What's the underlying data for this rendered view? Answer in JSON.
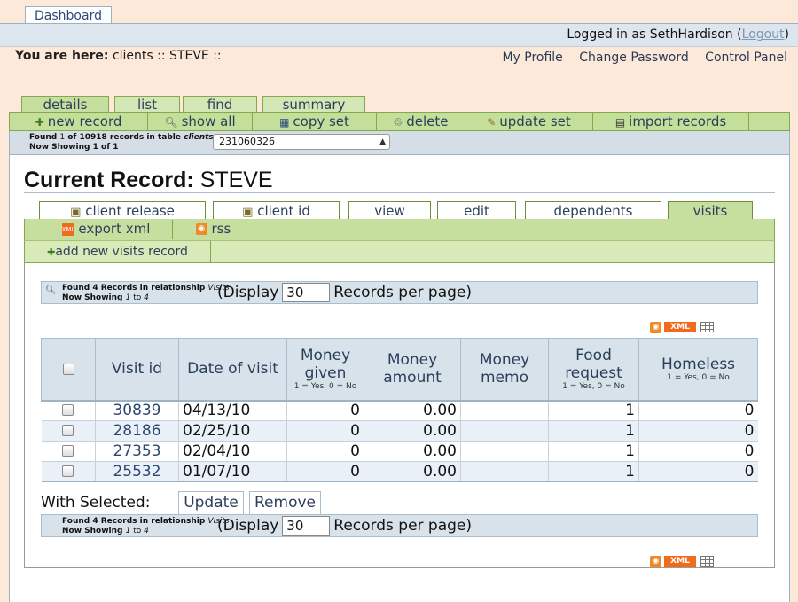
{
  "top": {
    "dashboard_tab": "Dashboard",
    "logged_in_text": "Logged in as SethHardison (",
    "logout": "Logout",
    "close_paren": ")"
  },
  "breadcrumb": {
    "label": "You are here:",
    "path": "clients :: STEVE ::"
  },
  "userlinks": [
    "My Profile",
    "Change Password",
    "Control Panel"
  ],
  "main_tabs": [
    "details",
    "list",
    "find",
    "summary"
  ],
  "actions": [
    {
      "label": "new record",
      "icon": "plus-icon"
    },
    {
      "label": "show all",
      "icon": "magnifier-icon"
    },
    {
      "label": "copy set",
      "icon": "table-icon"
    },
    {
      "label": "delete",
      "icon": "trash-icon"
    },
    {
      "label": "update set",
      "icon": "pencil-icon"
    },
    {
      "label": "import records",
      "icon": "printer-icon"
    }
  ],
  "found": {
    "line1_a": "Found ",
    "line1_n": "1",
    "line1_b": " of 10918 records in table ",
    "line1_table": "clients",
    "line2": "Now Showing 1 of 1",
    "selected_record": "231060326"
  },
  "record": {
    "label": "Current Record:",
    "name": "STEVE"
  },
  "sub_tabs": [
    "client release",
    "client id",
    "view",
    "edit",
    "dependents",
    "visits"
  ],
  "sub_tabs2": [
    "export xml",
    "rss"
  ],
  "add_new": "add new visits record",
  "display": {
    "found_line1": "Found 4 Records in relationship ",
    "found_rel": "Visits",
    "found_line2_a": "Now Showing ",
    "found_line2_range_a": "1",
    "found_line2_to": " to ",
    "found_line2_range_b": "4",
    "display_label": "(Display",
    "per_page": "30",
    "records_per_page": "Records per page)"
  },
  "feeds": {
    "xml": "XML"
  },
  "table": {
    "headers": [
      {
        "title": "Visit id",
        "sub": ""
      },
      {
        "title": "Date of visit",
        "sub": ""
      },
      {
        "title": "Money given",
        "sub": "1 = Yes, 0 = No"
      },
      {
        "title": "Money amount",
        "sub": ""
      },
      {
        "title": "Money memo",
        "sub": ""
      },
      {
        "title": "Food request",
        "sub": "1 = Yes, 0 = No"
      },
      {
        "title": "Homeless",
        "sub": "1 = Yes, 0 = No"
      }
    ],
    "rows": [
      [
        "30839",
        "04/13/10",
        "0",
        "0.00",
        "",
        "1",
        "0"
      ],
      [
        "28186",
        "02/25/10",
        "0",
        "0.00",
        "",
        "1",
        "0"
      ],
      [
        "27353",
        "02/04/10",
        "0",
        "0.00",
        "",
        "1",
        "0"
      ],
      [
        "25532",
        "01/07/10",
        "0",
        "0.00",
        "",
        "1",
        "0"
      ]
    ]
  },
  "with_selected": "With Selected:",
  "buttons": {
    "update": "Update",
    "remove": "Remove"
  }
}
